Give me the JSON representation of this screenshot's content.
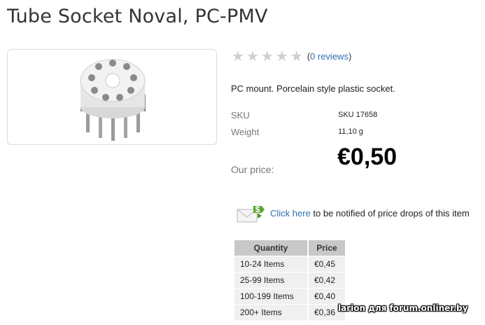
{
  "product": {
    "title": "Tube Socket Noval, PC-PMV",
    "image_alt": "tube-socket-photo",
    "rating": {
      "stars": 0,
      "max": 5,
      "reviews_open": "(",
      "reviews_link": "0 reviews",
      "reviews_close": ")"
    },
    "description": "PC mount. Porcelain style plastic socket.",
    "attributes": [
      {
        "label": "SKU",
        "value": "SKU 17658"
      },
      {
        "label": "Weight",
        "value": "11,10 g"
      }
    ],
    "our_price_label": "Our price:",
    "price": "€0,50"
  },
  "notify": {
    "icon": "email-price-drop-icon",
    "link_text": "Click here",
    "rest_text": " to be notified of price drops of this item"
  },
  "price_tiers": {
    "headers": [
      "Quantity",
      "Price"
    ],
    "rows": [
      {
        "quantity": "10-24 Items",
        "price": "€0,45"
      },
      {
        "quantity": "25-99 Items",
        "price": "€0,42"
      },
      {
        "quantity": "100-199 Items",
        "price": "€0,40"
      },
      {
        "quantity": "200+ Items",
        "price": "€0,36"
      }
    ]
  },
  "watermark": "larion для forum.onliner.by",
  "colors": {
    "link": "#2d6fb0",
    "star_empty": "#cfcfcf",
    "table_header": "#c8c8c8",
    "table_cell": "#f0f0f0"
  }
}
